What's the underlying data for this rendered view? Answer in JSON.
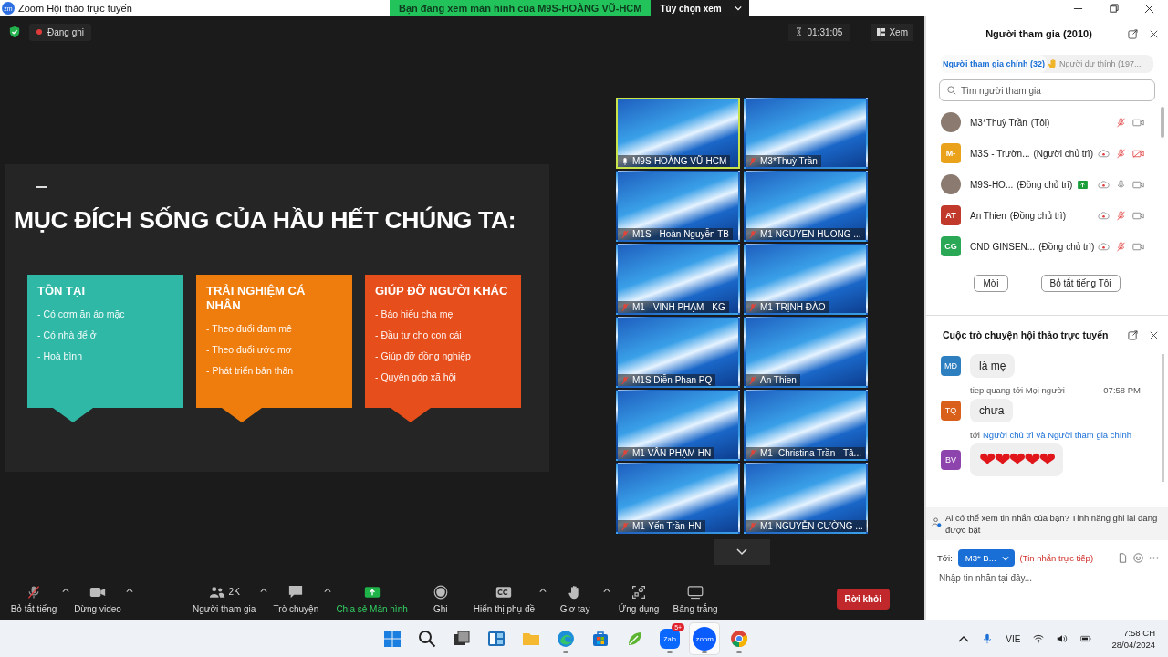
{
  "window": {
    "app_icon": "zm",
    "title": "Zoom Hội thảo trực tuyến"
  },
  "share_banner": {
    "text": "Bạn đang xem màn hình của M9S-HOÀNG VŨ-HCM",
    "button": "Tùy chọn xem"
  },
  "top_bar": {
    "recording": "Đang ghi",
    "timer": "01:31:05",
    "view_button": "Xem"
  },
  "slide": {
    "title": "MỤC ĐÍCH SỐNG CỦA HẦU HẾT CHÚNG TA:",
    "cards": [
      {
        "title": "TỒN TẠI",
        "color": "#2fb8a6",
        "items": [
          "- Có cơm ăn áo mặc",
          "- Có nhà để ở",
          "- Hoà bình"
        ]
      },
      {
        "title": "TRẢI NGHIỆM CÁ NHÂN",
        "color": "#ef7d0e",
        "items": [
          "- Theo đuổi đam mê",
          "- Theo đuổi ước mơ",
          "- Phát triển bản thân"
        ]
      },
      {
        "title": "GIÚP ĐỠ NGƯỜI KHÁC",
        "color": "#e64e1b",
        "items": [
          "- Báo hiếu cha mẹ",
          "- Đầu tư cho con cái",
          "- Giúp đỡ đồng nghiệp",
          "- Quyên góp xã hội"
        ]
      }
    ]
  },
  "video_tiles": [
    {
      "name": "M9S-HOÀNG VŨ-HCM",
      "muted": false,
      "speaking": true
    },
    {
      "name": "M3*Thuỳ Trần",
      "muted": true,
      "speaking": false
    },
    {
      "name": "M1S - Hoàn Nguyễn TB",
      "muted": true,
      "speaking": false
    },
    {
      "name": "M1 NGUYEN HUONG ...",
      "muted": true,
      "speaking": false
    },
    {
      "name": "M1 -  VINH PHẠM - KG",
      "muted": true,
      "speaking": false
    },
    {
      "name": "M1 TRỊNH ĐÀO",
      "muted": true,
      "speaking": false
    },
    {
      "name": "M1S Diễn Phan PQ",
      "muted": true,
      "speaking": false
    },
    {
      "name": "An Thien",
      "muted": true,
      "speaking": false
    },
    {
      "name": "M1 VÂN PHẠM HN",
      "muted": true,
      "speaking": false
    },
    {
      "name": "M1- Christina Trần - Tâ...",
      "muted": true,
      "speaking": false
    },
    {
      "name": "M1-Yến Trần-HN",
      "muted": true,
      "speaking": false
    },
    {
      "name": "M1 NGUYỄN CƯỜNG ...",
      "muted": true,
      "speaking": false
    }
  ],
  "toolbar": [
    {
      "kind": "mic-muted",
      "label": "Bỏ tắt tiếng",
      "caret": true
    },
    {
      "kind": "video",
      "label": "Dừng video",
      "caret": true
    },
    {
      "kind": "participants",
      "label": "Người tham gia",
      "badge": "2K",
      "caret": true
    },
    {
      "kind": "chat",
      "label": "Trò chuyện",
      "caret": true
    },
    {
      "kind": "share",
      "label": "Chia sẻ Màn hình",
      "caret": false
    },
    {
      "kind": "record",
      "label": "Ghi",
      "caret": false
    },
    {
      "kind": "captions",
      "label": "Hiển thị phụ đề",
      "caret": true
    },
    {
      "kind": "raise-hand",
      "label": "Giơ tay",
      "caret": true
    },
    {
      "kind": "apps",
      "label": "Ứng dụng",
      "caret": false
    },
    {
      "kind": "whiteboard",
      "label": "Bảng trắng",
      "caret": false
    }
  ],
  "leave_button": "Rời khỏi",
  "participants_panel": {
    "title": "Người tham gia (2010)",
    "tabs": [
      {
        "label": "Người tham gia chính (32)",
        "selected": true
      },
      {
        "label": "Người dự thính (197...",
        "selected": false
      }
    ],
    "search_placeholder": "Tìm người tham gia",
    "participants": [
      {
        "name": "M3*Thuỳ Trần",
        "role": "(Tôi)",
        "kind": "photo",
        "sharing": false,
        "recording": false,
        "mic_muted": true,
        "video_off": false
      },
      {
        "name": "M3S - Trườn...",
        "role": "(Người chủ trì)",
        "kind": "initials",
        "initials": "M-",
        "color": "#e9a21a",
        "sharing": false,
        "recording": true,
        "mic_muted": true,
        "video_off": true
      },
      {
        "name": "M9S-HO...",
        "role": "(Đồng chủ trì)",
        "kind": "photo",
        "sharing": true,
        "recording": true,
        "mic_muted": false,
        "video_off": false
      },
      {
        "name": "An Thien",
        "role": "(Đồng chủ trì)",
        "kind": "initials",
        "initials": "AT",
        "color": "#c0392b",
        "sharing": false,
        "recording": true,
        "mic_muted": true,
        "video_off": false
      },
      {
        "name": "CND GINSEN...",
        "role": "(Đồng chủ trì)",
        "kind": "initials",
        "initials": "CG",
        "color": "#2aa856",
        "sharing": false,
        "recording": true,
        "mic_muted": true,
        "video_off": false
      }
    ],
    "buttons": [
      "Mời",
      "Bỏ tắt tiếng Tôi"
    ]
  },
  "chat_panel": {
    "title": "Cuộc trò chuyện hội thảo trực tuyến",
    "messages": [
      {
        "initials": "MĐ",
        "color": "#2e7fbf",
        "text": "là mẹ"
      },
      {
        "initials": "TQ",
        "color": "#d9601a",
        "sender": "tiep quang tới Mọi người",
        "time": "07:58 PM",
        "text": "chưa"
      },
      {
        "initials": "BV",
        "color": "#8e44ad",
        "to_prefix": "tới",
        "to": "Người chủ trì và Người tham gia chính",
        "text": "❤❤❤❤❤",
        "kind": "hearts"
      }
    ],
    "notice": "Ai có thể xem tin nhắn của bạn? Tính năng ghi lại đang được bật",
    "to_label": "Tới:",
    "recipient": "M3* B...",
    "direct_note": "(Tin nhắn trực tiếp)",
    "placeholder": "Nhập tin nhắn tại đây..."
  },
  "taskbar": {
    "apps": [
      {
        "kind": "start",
        "running": false,
        "selected": false
      },
      {
        "kind": "search",
        "running": false,
        "selected": false
      },
      {
        "kind": "task-view",
        "running": false,
        "selected": false
      },
      {
        "kind": "widgets",
        "running": false,
        "selected": false
      },
      {
        "kind": "folder",
        "running": false,
        "selected": false
      },
      {
        "kind": "edge",
        "running": true,
        "selected": false
      },
      {
        "kind": "store",
        "running": false,
        "selected": false
      },
      {
        "kind": "leaf",
        "running": false,
        "selected": false
      },
      {
        "kind": "zalo",
        "label": "Zalo",
        "badge": "5+",
        "running": true,
        "selected": false
      },
      {
        "kind": "zoom",
        "label": "zoom",
        "running": true,
        "selected": true
      },
      {
        "kind": "chrome",
        "running": true,
        "selected": false
      }
    ],
    "language": "VIE",
    "time": "7:58 CH",
    "date": "28/04/2024"
  }
}
